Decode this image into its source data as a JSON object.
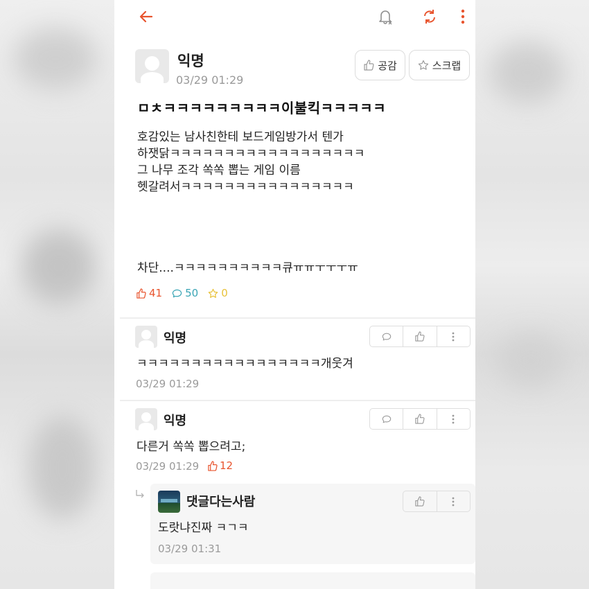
{
  "colors": {
    "accent": "#e8542e",
    "teal": "#3aa5b5",
    "gold": "#e8c23a"
  },
  "topbar": {
    "back_icon": "arrow-left-icon",
    "bell_icon": "bell-off-icon",
    "refresh_icon": "refresh-icon",
    "more_icon": "more-vertical-icon"
  },
  "post": {
    "author": "익명",
    "time": "03/29 01:29",
    "like_button": "공감",
    "scrap_button": "스크랩",
    "title": "ㅁㅊㅋㅋㅋㅋㅋㅋㅋㅋㅋ이불킥ㅋㅋㅋㅋㅋ",
    "body_lines": [
      "호감있는 남사친한테 보드게임방가서 텐가",
      "하잿닭ㅋㅋㅋㅋㅋㅋㅋㅋㅋㅋㅋㅋㅋㅋㅋㅋㅋㅋ",
      "그 나무 조각 쏙쏙 뽑는 게임 이름",
      "헷갈려서ㅋㅋㅋㅋㅋㅋㅋㅋㅋㅋㅋㅋㅋㅋㅋㅋ"
    ],
    "body_end": "차단....ㅋㅋㅋㅋㅋㅋㅋㅋㅋㅋ큐ㅠㅠㅜㅜㅜㅠ",
    "likes": "41",
    "comments": "50",
    "scraps": "0"
  },
  "comments": [
    {
      "author": "익명",
      "text": "ㅋㅋㅋㅋㅋㅋㅋㅋㅋㅋㅋㅋㅋㅋㅋㅋㅋ개웃겨",
      "time": "03/29 01:29"
    },
    {
      "author": "익명",
      "text": "다른거 쏙쏙 뽑으려고;",
      "time": "03/29 01:29",
      "likes": "12"
    }
  ],
  "reply": {
    "author": "댓글다는사람",
    "text": "도랏냐진짜 ㅋㄱㅋ",
    "time": "03/29 01:31"
  }
}
